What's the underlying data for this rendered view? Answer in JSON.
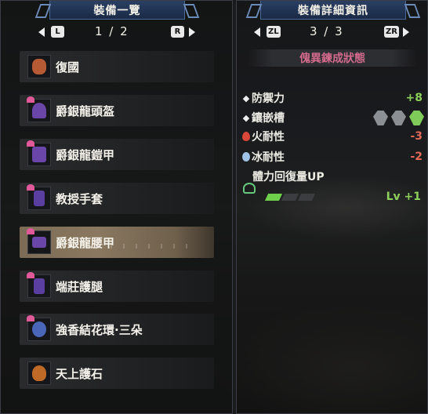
{
  "left_panel": {
    "title": "裝備一覽",
    "prev_button": "L",
    "next_button": "R",
    "page": "1 / 2",
    "items": [
      {
        "name": "復國",
        "icon": "charm-icon",
        "color": "#b55a34"
      },
      {
        "name": "爵銀龍頭盔",
        "icon": "helmet-icon",
        "color": "#6a46a8"
      },
      {
        "name": "爵銀龍鎧甲",
        "icon": "chest-icon",
        "color": "#6a46a8"
      },
      {
        "name": "教授手套",
        "icon": "gloves-icon",
        "color": "#5a3fa0"
      },
      {
        "name": "爵銀龍腰甲",
        "icon": "waist-icon",
        "color": "#6a46a8"
      },
      {
        "name": "端莊護腿",
        "icon": "legs-icon",
        "color": "#5a3fa0"
      },
      {
        "name": "強香結花環·三朵",
        "icon": "garland-icon",
        "color": "#4a66b8"
      },
      {
        "name": "天上護石",
        "icon": "talisman-icon",
        "color": "#c06a28"
      }
    ],
    "selected_index": 4
  },
  "right_panel": {
    "title": "裝備詳細資訊",
    "prev_button": "ZL",
    "next_button": "ZR",
    "page": "3 / 3",
    "section": "傀異鍊成狀態",
    "defense": {
      "label": "防禦力",
      "value": "+8"
    },
    "slots": {
      "label": "鑲嵌槽",
      "filled": [
        false,
        false,
        true
      ]
    },
    "fire_res": {
      "label": "火耐性",
      "value": "-3"
    },
    "ice_res": {
      "label": "冰耐性",
      "value": "-2"
    },
    "skill": {
      "label": "體力回復量UP",
      "level_text": "Lv +1",
      "level": 1,
      "max_level": 3
    }
  }
}
